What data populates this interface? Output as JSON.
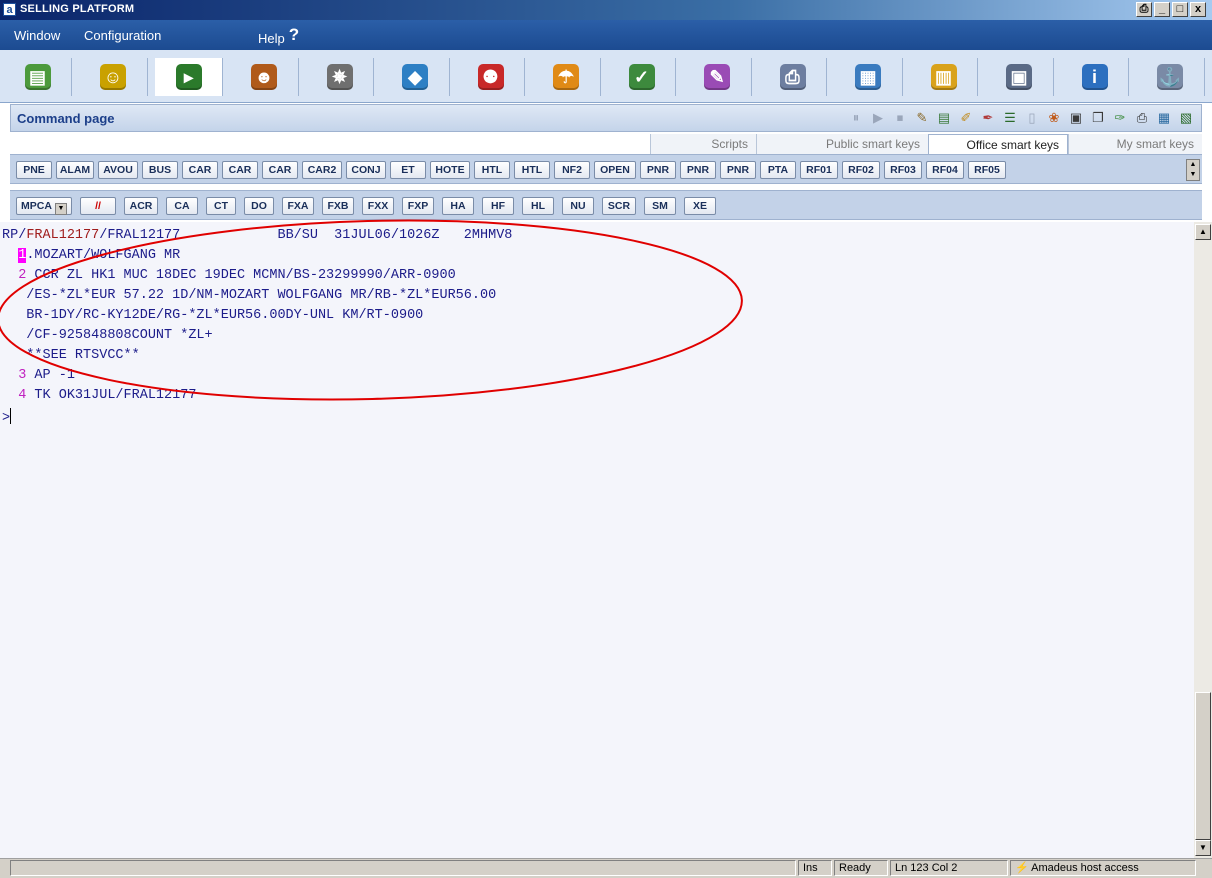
{
  "window": {
    "app_icon": "a",
    "title": "SELLING PLATFORM",
    "btn_print": "⎙",
    "btn_min": "_",
    "btn_max": "□",
    "btn_close": "x"
  },
  "menu": {
    "window": "Window",
    "configuration": "Configuration",
    "help": "Help",
    "help_mark": "?"
  },
  "iconbar": [
    {
      "icon": "book-icon",
      "glyph": "▤",
      "color": "#4c9a3c"
    },
    {
      "icon": "smiley-icon",
      "glyph": "☺",
      "color": "#c9a100"
    },
    {
      "icon": "terminal-icon",
      "glyph": "▸",
      "color": "#2b7a2b"
    },
    {
      "icon": "agent-icon",
      "glyph": "☻",
      "color": "#b05a1a"
    },
    {
      "icon": "satellite-icon",
      "glyph": "✵",
      "color": "#6f6f6f"
    },
    {
      "icon": "car-icon",
      "glyph": "◆",
      "color": "#2d7fc4"
    },
    {
      "icon": "bellboy-icon",
      "glyph": "⚉",
      "color": "#c82828"
    },
    {
      "icon": "umbrella-icon",
      "glyph": "☂",
      "color": "#e08a16"
    },
    {
      "icon": "plane-check-icon",
      "glyph": "✓",
      "color": "#3d8a3d"
    },
    {
      "icon": "notepad-icon",
      "glyph": "✎",
      "color": "#9a4bb5"
    },
    {
      "icon": "printer-icon",
      "glyph": "⎙",
      "color": "#6d7ea0"
    },
    {
      "icon": "database-icon",
      "glyph": "▦",
      "color": "#3a7bbf"
    },
    {
      "icon": "folder-icon",
      "glyph": "▥",
      "color": "#d9a21b"
    },
    {
      "icon": "document-icon",
      "glyph": "▣",
      "color": "#5a6a86"
    },
    {
      "icon": "info-icon",
      "glyph": "i",
      "color": "#2c6fbf"
    },
    {
      "icon": "ship-icon",
      "glyph": "⚓",
      "color": "#7a8aa6"
    }
  ],
  "command_page": {
    "title": "Command page"
  },
  "tabs": [
    {
      "label": "Scripts"
    },
    {
      "label": "Public smart keys"
    },
    {
      "label": "Office smart keys"
    },
    {
      "label": "My smart keys"
    }
  ],
  "smartkeys": [
    "PNE",
    "ALAM",
    "AVOU",
    "BUS",
    "CAR",
    "CAR",
    "CAR",
    "CAR2",
    "CONJ",
    "ET",
    "HOTE",
    "HTL",
    "HTL",
    "NF2",
    "OPEN",
    "PNR",
    "PNR",
    "PNR",
    "PTA",
    "RF01",
    "RF02",
    "RF03",
    "RF04",
    "RF05"
  ],
  "commandkeys": {
    "mpca": "MPCA",
    "dd": "▼",
    "slash": "//",
    "keys": [
      "ACR",
      "CA",
      "CT",
      "DO",
      "FXA",
      "FXB",
      "FXX",
      "FXP",
      "HA",
      "HF",
      "HL",
      "NU",
      "SCR",
      "SM",
      "XE"
    ]
  },
  "terminal": {
    "l0_rp": "RP/",
    "l0_office1": "FRAL12177",
    "l0_mid": "/FRAL12177            BB/SU  31JUL06/1026Z   2MHMV8",
    "l1_num": "1",
    "l1_text": ".MOZART/WOLFGANG MR",
    "l2_num": "2",
    "l2_text": " CCR ZL HK1 MUC 18DEC 19DEC MCMN/BS-23299990/ARR-0900",
    "l3": "   /ES-*ZL*EUR 57.22 1D/NM-MOZART WOLFGANG MR/RB-*ZL*EUR56.00",
    "l4": "   BR-1DY/RC-KY12DE/RG-*ZL*EUR56.00DY-UNL KM/RT-0900",
    "l5": "   /CF-925848808COUNT *ZL+",
    "l6": "   **SEE RTSVCC**",
    "l7_num": "3",
    "l7_text": " AP -1",
    "l8_num": "4",
    "l8_text": " TK OK31JUL/FRAL12177",
    "prompt": ">"
  },
  "status": {
    "ins": "Ins",
    "ready": "Ready",
    "position": "Ln 123 Col 2",
    "host": "Amadeus host access",
    "bolt": "⚡"
  },
  "scroll": {
    "up": "▲",
    "down": "▼"
  },
  "colors": {
    "oval": "#e00000",
    "accent": "#1c4b91"
  }
}
